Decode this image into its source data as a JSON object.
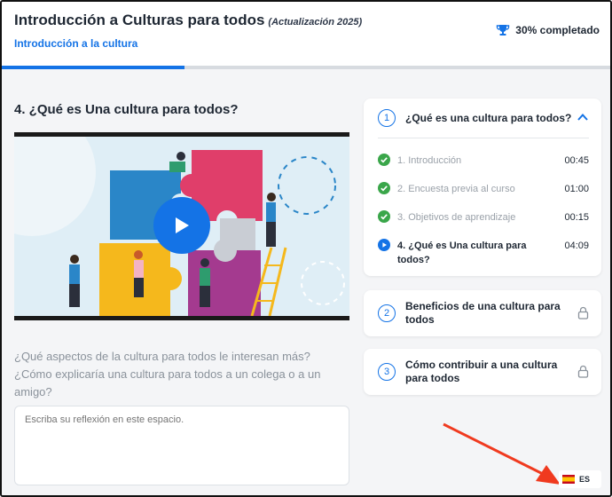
{
  "header": {
    "course_title": "Introducción a Culturas para todos",
    "update_note": "(Actualización 2025)",
    "section_link": "Introducción a la cultura",
    "progress_text": "30% completado",
    "progress_fraction": 0.3
  },
  "main": {
    "lesson_title": "4. ¿Qué es Una cultura para todos?",
    "question": "¿Qué aspectos de la cultura para todos le interesan más? ¿Cómo explicaría una cultura para todos a un colega o a un amigo?",
    "reflection_placeholder": "Escriba su reflexión en este espacio."
  },
  "sidebar": {
    "modules": [
      {
        "number": "1",
        "title": "¿Qué es una cultura para todos?",
        "expanded": true,
        "lessons": [
          {
            "name": "1. Introducción",
            "duration": "00:45",
            "status": "completed"
          },
          {
            "name": "2. Encuesta previa al curso",
            "duration": "01:00",
            "status": "completed"
          },
          {
            "name": "3. Objetivos de aprendizaje",
            "duration": "00:15",
            "status": "completed"
          },
          {
            "name": "4. ¿Qué es Una cultura para todos?",
            "duration": "04:09",
            "status": "current"
          }
        ]
      },
      {
        "number": "2",
        "title": "Beneficios de una cultura para todos",
        "locked": true
      },
      {
        "number": "3",
        "title": "Cómo contribuir a una cultura para todos",
        "locked": true
      }
    ]
  },
  "language": {
    "code": "ES"
  },
  "colors": {
    "accent": "#1473e6",
    "completed": "#3aa64a",
    "annotation_arrow": "#f03a1f"
  },
  "icons": [
    "trophy-icon",
    "chevron-up-icon",
    "check-circle-icon",
    "play-circle-icon",
    "lock-icon",
    "play-icon",
    "flag-spain-icon"
  ]
}
